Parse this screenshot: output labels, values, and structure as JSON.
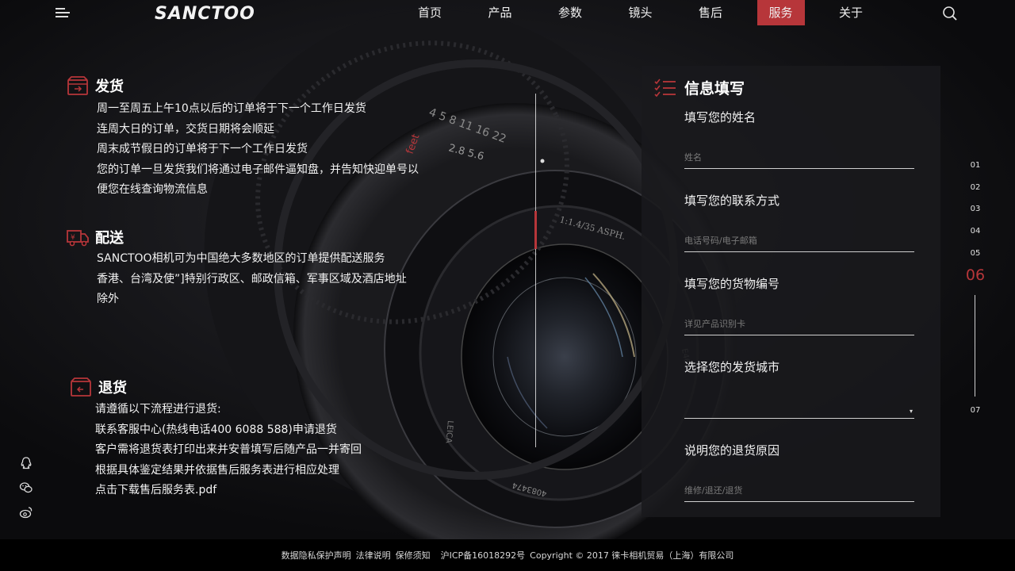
{
  "header": {
    "logo": "SANCTOO",
    "nav": [
      "首页",
      "产品",
      "参数",
      "镜头",
      "售后",
      "服务",
      "关于"
    ],
    "active_nav": "服务"
  },
  "sections": {
    "shipping": {
      "title": "发货",
      "lines": [
        "周一至周五上午10点以后的订单将于下一个工作日发货",
        "连周大日的订单，交货日期将会顺延",
        "周末成节假日的订单将于下一个工作日发货",
        "您的订单一旦发货我们将通过电子邮件逼知盘，并告知快迎单号以",
        "便您在线查询物流信息"
      ]
    },
    "delivery": {
      "title": "配送",
      "lines": [
        "SANCTOO相机可为中国绝大多数地区的订单提供配送服务",
        "香港、台湾及使”]特别行政区、邮政信箱、军事区域及酒店地址",
        "除外"
      ]
    },
    "returns": {
      "title": "退货",
      "lines": [
        "请遵循以下流程进行退货:",
        "联系客服中心(热线电话400 6088 588)申请退货",
        "客户需将退货表打印出来并安普填写后随产品一并寄回",
        "根据具体鉴定结果并依据售后服务表进行相应处理"
      ],
      "download": "点击下载售后服务表.pdf"
    }
  },
  "form": {
    "title": "信息填写",
    "fields": [
      {
        "label": "填写您的姓名",
        "placeholder": "姓名"
      },
      {
        "label": "填写您的联系方式",
        "placeholder": "电话号码/电子邮箱"
      },
      {
        "label": "填写您的货物编号",
        "placeholder": "详见产品识别卡"
      },
      {
        "label": "选择您的发货城市",
        "placeholder": ""
      },
      {
        "label": "说明您的退货原因",
        "placeholder": "维修/退还/退货"
      }
    ],
    "select_caret": "▾"
  },
  "pager": {
    "items": [
      "01",
      "02",
      "03",
      "04",
      "05",
      "06",
      "07"
    ],
    "active": "06"
  },
  "social_icons": [
    "qq-icon",
    "wechat-icon",
    "weibo-icon"
  ],
  "footer": {
    "links": [
      "数据隐私保护声明",
      "法律说明",
      "保修须知"
    ],
    "icp": "沪ICP备16018292号",
    "copyright": "Copyright © 2017 徕卡相机贸易（上海）有限公司"
  },
  "colors": {
    "accent": "#b7363a",
    "background": "#0b0b0d",
    "panel": "#19191c"
  },
  "lens_markings": [
    "1:1.4/35 ASPH.",
    "feet",
    "m",
    "2.8",
    "5.6",
    "E46",
    "4083474",
    "LEICA",
    "SUMMILUX-M"
  ]
}
